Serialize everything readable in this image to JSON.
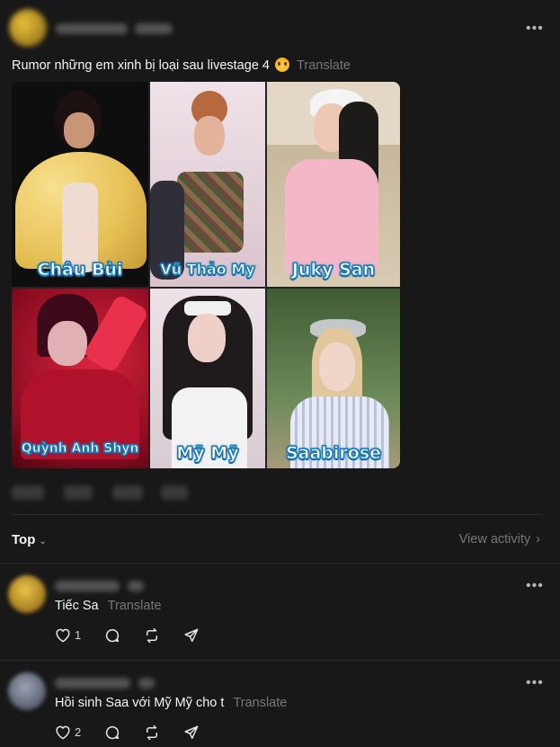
{
  "post": {
    "text": "Rumor những em xinh bị loại sau livestage 4",
    "translate": "Translate",
    "more": "•••",
    "images": [
      {
        "name": "Châu Bùi",
        "bg": "#0d0d0d",
        "accent": "#f0d27a"
      },
      {
        "name": "Vũ Thảo My",
        "bg": "#e9d7df",
        "accent": "#b26a5a"
      },
      {
        "name": "Juky San",
        "bg": "#cbb89c",
        "accent": "#f4b3c8"
      },
      {
        "name": "Quỳnh Anh Shyn",
        "bg": "#a8142c",
        "accent": "#e0203a"
      },
      {
        "name": "Mỹ Mỹ",
        "bg": "#e7dce3",
        "accent": "#2a2324"
      },
      {
        "name": "Saabirose",
        "bg": "#5c7a4a",
        "accent": "#d8c9b0"
      }
    ]
  },
  "sort": {
    "label": "Top"
  },
  "view_activity": "View activity",
  "replies": [
    {
      "text": "Tiếc Sa",
      "translate": "Translate",
      "likes": "1",
      "more": "•••"
    },
    {
      "text": "Hồi sinh Saa với Mỹ Mỹ cho t",
      "translate": "Translate",
      "likes": "2",
      "more": "•••"
    }
  ],
  "colors": {
    "background": "#181818",
    "text": "#f3f5f7",
    "muted": "#777777",
    "divider": "#2e2e2e",
    "label_stroke": "#1a7ab8"
  }
}
